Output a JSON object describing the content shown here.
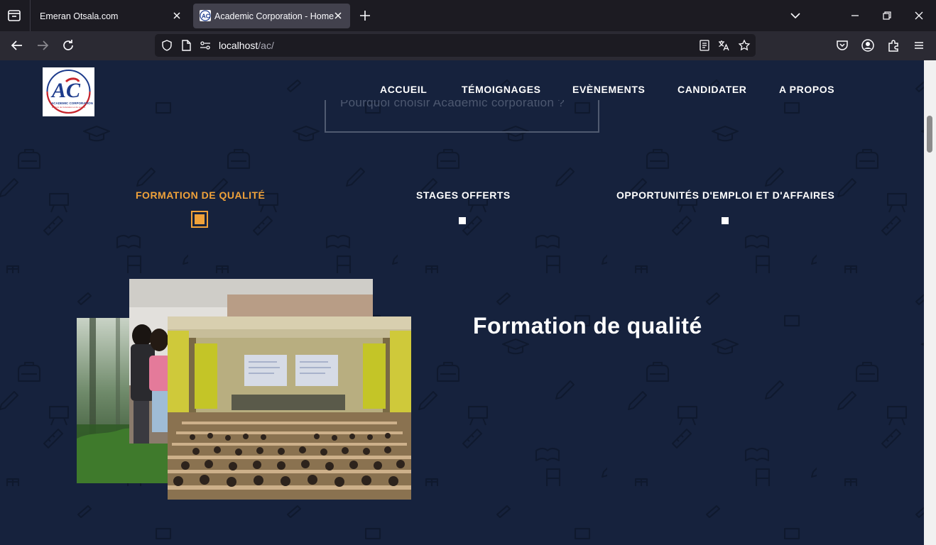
{
  "browser": {
    "tabs": [
      {
        "title": "Emeran Otsala.com",
        "active": false
      },
      {
        "title": "Academic Corporation - Home",
        "active": true
      }
    ],
    "url": {
      "host": "localhost",
      "path": "/ac/"
    }
  },
  "site": {
    "logo": {
      "letters": "AC",
      "name": "ACADEMIC CORPORATION",
      "tagline": "le choix de l'education et du succes"
    },
    "menu": [
      "ACCUEIL",
      "TÉMOIGNAGES",
      "EVÈNEMENTS",
      "CANDIDATER",
      "A PROPOS"
    ],
    "why_button": "Pourquoi choisir Academic corporation ?",
    "feature_tabs": [
      {
        "label": "FORMATION DE QUALITÉ",
        "active": true
      },
      {
        "label": "STAGES OFFERTS",
        "active": false
      },
      {
        "label": "OPPORTUNITÉS D'EMPLOI ET D'AFFAIRES",
        "active": false
      }
    ],
    "section_title": "Formation de qualité"
  },
  "colors": {
    "page_bg": "#16223d",
    "accent": "#f0a23a",
    "chrome_dark": "#1c1b22",
    "chrome_toolbar": "#2b2a33",
    "active_tab": "#42414d"
  }
}
